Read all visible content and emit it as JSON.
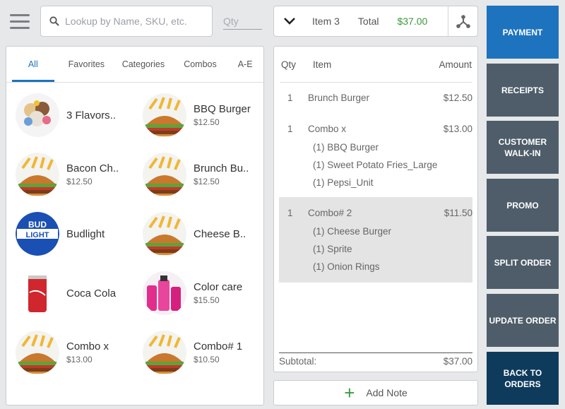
{
  "search": {
    "placeholder": "Lookup by Name, SKU, etc.",
    "qty_placeholder": "Qty"
  },
  "order_header": {
    "item_count": "Item 3",
    "total_label": "Total",
    "total_value": "$37.00"
  },
  "tabs": [
    "All",
    "Favorites",
    "Categories",
    "Combos",
    "A-E"
  ],
  "products": [
    {
      "name": "3 Flavors..",
      "price": "",
      "thumb": "dessert"
    },
    {
      "name": "BBQ Burger",
      "price": "$12.50",
      "thumb": "burger"
    },
    {
      "name": "Bacon Ch..",
      "price": "$12.50",
      "thumb": "burger"
    },
    {
      "name": "Brunch Bu..",
      "price": "$12.50",
      "thumb": "burger"
    },
    {
      "name": "Budlight",
      "price": "",
      "thumb": "budlight"
    },
    {
      "name": "Cheese B..",
      "price": "",
      "thumb": "burger"
    },
    {
      "name": "Coca Cola",
      "price": "",
      "thumb": "coke"
    },
    {
      "name": "Color care",
      "price": "$15.50",
      "thumb": "colorcare"
    },
    {
      "name": "Combo x",
      "price": "$13.00",
      "thumb": "burger"
    },
    {
      "name": "Combo# 1",
      "price": "$10.50",
      "thumb": "burger"
    }
  ],
  "ticket": {
    "headers": {
      "qty": "Qty",
      "item": "Item",
      "amount": "Amount"
    },
    "lines": [
      {
        "qty": "1",
        "name": "Brunch Burger",
        "amount": "$12.50",
        "modifiers": []
      },
      {
        "qty": "1",
        "name": "Combo x",
        "amount": "$13.00",
        "modifiers": [
          "(1) BBQ Burger",
          "(1) Sweet Potato Fries_Large",
          "(1) Pepsi_Unit"
        ]
      },
      {
        "qty": "1",
        "name": "Combo# 2",
        "amount": "$11.50",
        "modifiers": [
          "(1) Cheese Burger",
          "(1) Sprite",
          "(1) Onion Rings"
        ]
      }
    ],
    "subtotal_label": "Subtotal:",
    "subtotal_value": "$37.00"
  },
  "add_note_label": "Add Note",
  "actions": {
    "payment": "PAYMENT",
    "receipts": "RECEIPTS",
    "customer_walkin": "CUSTOMER\nWALK-IN",
    "promo": "PROMO",
    "split_order": "SPLIT ORDER",
    "update_order": "UPDATE ORDER",
    "back_to_orders": "BACK TO\nORDERS"
  },
  "colors": {
    "accent": "#1e73be",
    "action_button": "#4e5d69",
    "back_button": "#0e3b5c",
    "total_green": "#3a9a3a"
  }
}
